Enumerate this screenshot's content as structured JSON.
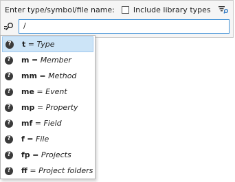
{
  "header": {
    "prompt_label": "Enter type/symbol/file name:",
    "include_library_label": "Include library types",
    "include_library_checked": false
  },
  "search": {
    "value": "/"
  },
  "icons": {
    "search": "search-icon",
    "filter": "filter-icon",
    "help": "question-circle-icon"
  },
  "suggestions": [
    {
      "abbr": "t",
      "eq": " = ",
      "desc": "Type",
      "selected": true
    },
    {
      "abbr": "m",
      "eq": " = ",
      "desc": "Member",
      "selected": false
    },
    {
      "abbr": "mm",
      "eq": " = ",
      "desc": "Method",
      "selected": false
    },
    {
      "abbr": "me",
      "eq": " = ",
      "desc": "Event",
      "selected": false
    },
    {
      "abbr": "mp",
      "eq": " = ",
      "desc": "Property",
      "selected": false
    },
    {
      "abbr": "mf",
      "eq": " = ",
      "desc": "Field",
      "selected": false
    },
    {
      "abbr": "f",
      "eq": " = ",
      "desc": "File",
      "selected": false
    },
    {
      "abbr": "fp",
      "eq": " = ",
      "desc": "Projects",
      "selected": false
    },
    {
      "abbr": "ff",
      "eq": " = ",
      "desc": "Project folders",
      "selected": false
    }
  ],
  "colors": {
    "selected_bg": "#cce4f7",
    "input_border": "#3c8fd6"
  }
}
